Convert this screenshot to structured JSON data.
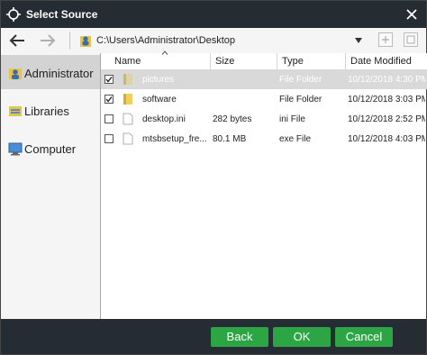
{
  "window": {
    "title": "Select Source"
  },
  "toolbar": {
    "path": "C:\\Users\\Administrator\\Desktop"
  },
  "sidebar": {
    "items": [
      {
        "label": "Administrator",
        "icon": "user-folder-icon",
        "selected": true
      },
      {
        "label": "Libraries",
        "icon": "libraries-icon",
        "selected": false
      },
      {
        "label": "Computer",
        "icon": "computer-icon",
        "selected": false
      }
    ]
  },
  "columns": {
    "name": "Name",
    "size": "Size",
    "type": "Type",
    "date": "Date Modified"
  },
  "files": [
    {
      "name": "pictures",
      "size": "",
      "type": "File Folder",
      "date": "10/12/2018 4:30 PM",
      "checked": true,
      "selected": true,
      "icon": "folder-icon"
    },
    {
      "name": "software",
      "size": "",
      "type": "File Folder",
      "date": "10/12/2018 3:03 PM",
      "checked": true,
      "selected": false,
      "icon": "folder-icon"
    },
    {
      "name": "desktop.ini",
      "size": "282 bytes",
      "type": "ini File",
      "date": "10/12/2018 2:52 PM",
      "checked": false,
      "selected": false,
      "icon": "file-icon"
    },
    {
      "name": "mtsbsetup_fre...",
      "size": "80.1 MB",
      "type": "exe File",
      "date": "10/12/2018 4:03 PM",
      "checked": false,
      "selected": false,
      "icon": "file-icon"
    }
  ],
  "buttons": {
    "back": "Back",
    "ok": "OK",
    "cancel": "Cancel"
  },
  "colors": {
    "titlebar": "#252c33",
    "button": "#2ca544",
    "selected_row": "#d9d9d9"
  }
}
